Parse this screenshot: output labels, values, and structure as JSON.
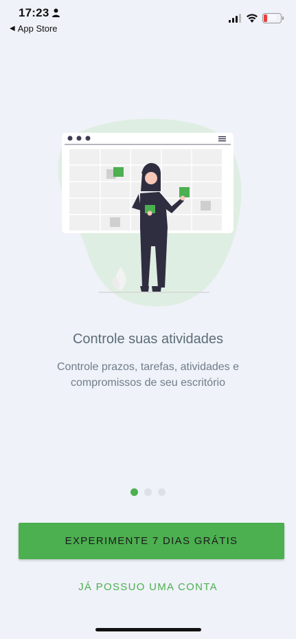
{
  "status_bar": {
    "time": "17:23",
    "back_label": "App Store",
    "battery_level": "20",
    "icons": [
      "person-icon",
      "signal-icon",
      "wifi-icon",
      "battery-icon"
    ]
  },
  "onboarding": {
    "title": "Controle suas atividades",
    "subtitle": "Controle prazos, tarefas, atividades e compromissos de seu escritório",
    "pages_total": 3,
    "current_page": 1
  },
  "actions": {
    "primary_label": "EXPERIMENTE 7 DIAS GRÁTIS",
    "secondary_label": "JÁ POSSUO UMA CONTA"
  },
  "colors": {
    "accent": "#4caf50",
    "background": "#eff2f8",
    "title_text": "#5b6c78"
  }
}
